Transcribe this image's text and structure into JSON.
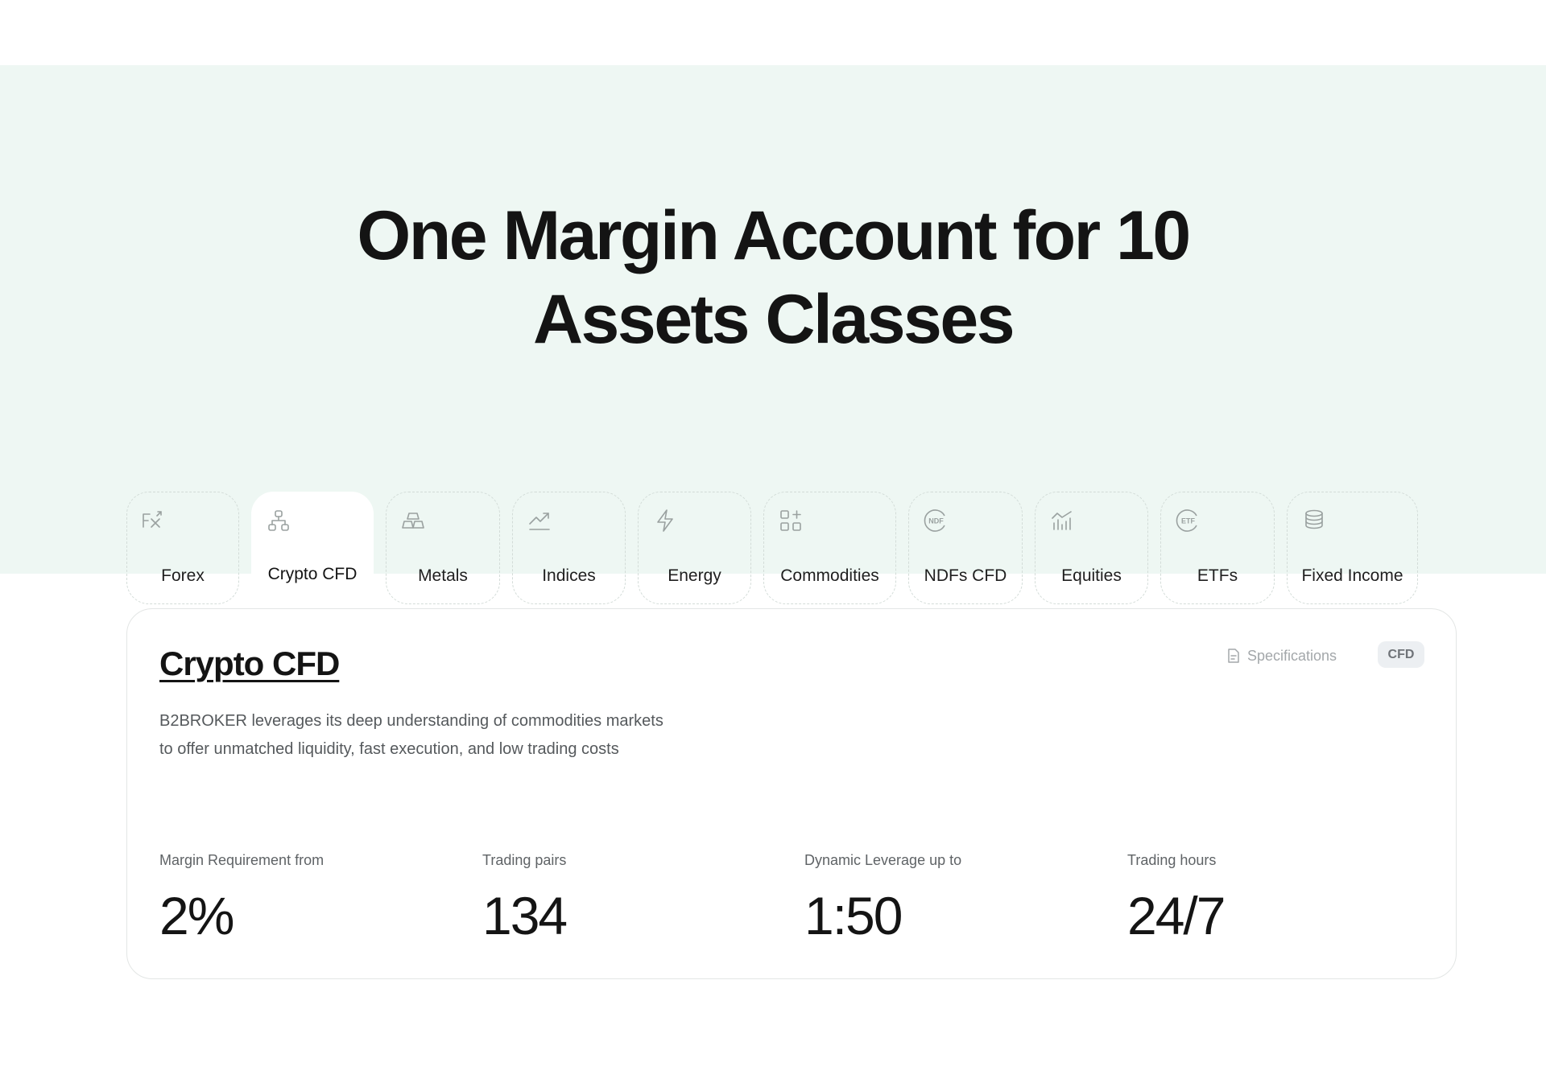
{
  "hero": {
    "title_line1": "One Margin Account for 10",
    "title_line2": "Assets Classes"
  },
  "tabs": [
    {
      "label": "Forex",
      "icon": "fx-icon",
      "active": false
    },
    {
      "label": "Crypto CFD",
      "icon": "crypto-network-icon",
      "active": true
    },
    {
      "label": "Metals",
      "icon": "gold-bars-icon",
      "active": false
    },
    {
      "label": "Indices",
      "icon": "trending-up-icon",
      "active": false
    },
    {
      "label": "Energy",
      "icon": "lightning-icon",
      "active": false
    },
    {
      "label": "Commodities",
      "icon": "grid-plus-icon",
      "active": false
    },
    {
      "label": "NDFs CFD",
      "icon": "ndf-coin-icon",
      "active": false
    },
    {
      "label": "Equities",
      "icon": "chart-bars-icon",
      "active": false
    },
    {
      "label": "ETFs",
      "icon": "etf-coin-icon",
      "active": false
    },
    {
      "label": "Fixed Income",
      "icon": "coin-stack-icon",
      "active": false
    }
  ],
  "card": {
    "title": "Crypto CFD",
    "description": "B2BROKER leverages its deep understanding of commodities markets to offer unmatched liquidity, fast execution, and low trading costs",
    "specifications_label": "Specifications",
    "badge": "CFD",
    "stats": [
      {
        "label": "Margin Requirement from",
        "value": "2%"
      },
      {
        "label": "Trading pairs",
        "value": "134"
      },
      {
        "label": "Dynamic Leverage up to",
        "value": "1:50"
      },
      {
        "label": "Trading hours",
        "value": "24/7"
      }
    ]
  },
  "colors": {
    "hero_background": "#eef7f3",
    "text_primary": "#141414",
    "icon_gray": "#9aa1a0",
    "badge_background": "#eceff2"
  }
}
